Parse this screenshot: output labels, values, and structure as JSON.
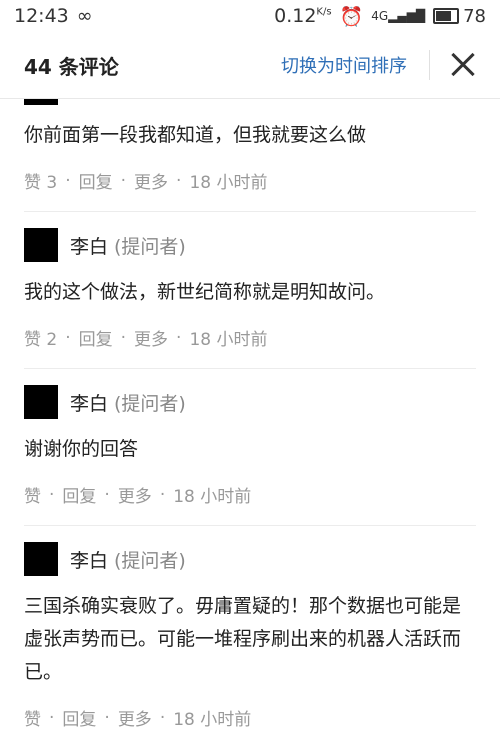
{
  "status": {
    "time": "12:43",
    "speed": "0.12",
    "speed_unit": "K/s",
    "network": "4G",
    "battery": "78"
  },
  "header": {
    "count": "44 条评论",
    "sort_label": "切换为时间排序"
  },
  "comments": [
    {
      "author": "",
      "role": "",
      "text": "你前面第一段我都知道，但我就要这么做",
      "like": "赞 3",
      "reply": "回复",
      "more": "更多",
      "time": "18 小时前"
    },
    {
      "author": "李白",
      "role": "(提问者)",
      "text": "我的这个做法，新世纪简称就是明知故问。",
      "like": "赞 2",
      "reply": "回复",
      "more": "更多",
      "time": "18 小时前"
    },
    {
      "author": "李白",
      "role": "(提问者)",
      "text": "谢谢你的回答",
      "like": "赞",
      "reply": "回复",
      "more": "更多",
      "time": "18 小时前"
    },
    {
      "author": "李白",
      "role": "(提问者)",
      "text": "三国杀确实衰败了。毋庸置疑的！那个数据也可能是虚张声势而已。可能一堆程序刷出来的机器人活跃而已。",
      "like": "赞",
      "reply": "回复",
      "more": "更多",
      "time": "18 小时前"
    }
  ]
}
